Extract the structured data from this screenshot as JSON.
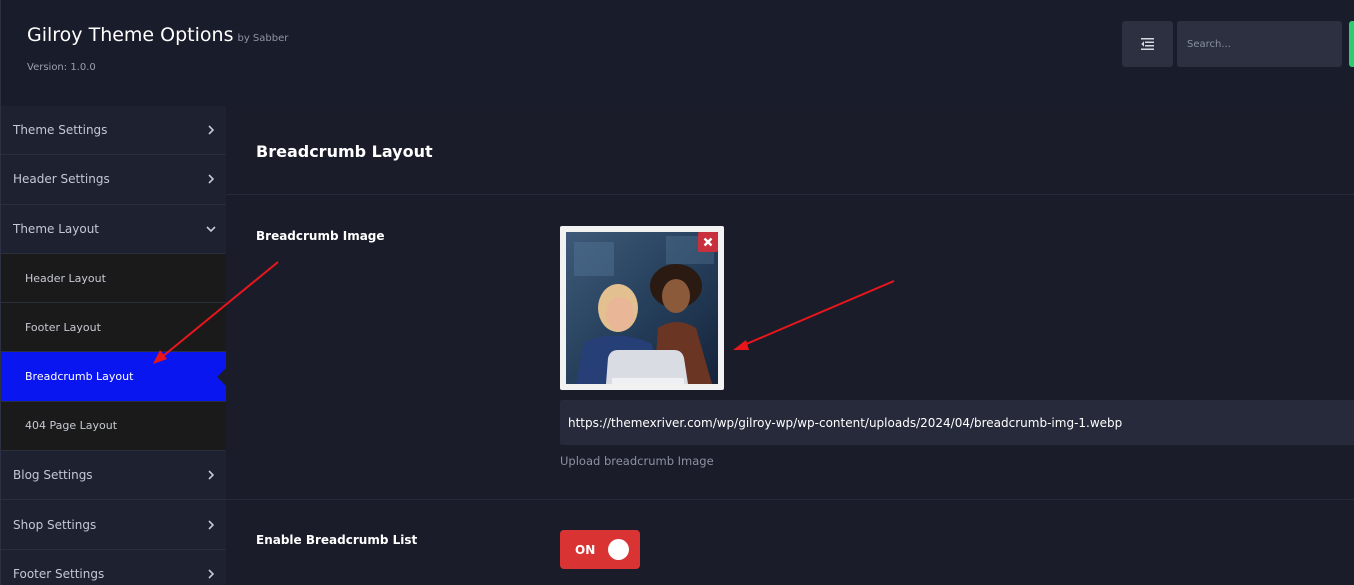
{
  "header": {
    "title": "Gilroy Theme Options",
    "by": "by Sabber",
    "version": "Version: 1.0.0",
    "search_placeholder": "Search..."
  },
  "sidebar": {
    "items": [
      {
        "label": "Theme Settings"
      },
      {
        "label": "Header Settings"
      },
      {
        "label": "Theme Layout"
      },
      {
        "label": "Header Layout"
      },
      {
        "label": "Footer Layout"
      },
      {
        "label": "Breadcrumb Layout"
      },
      {
        "label": "404 Page Layout"
      },
      {
        "label": "Blog Settings"
      },
      {
        "label": "Shop Settings"
      },
      {
        "label": "Footer Settings"
      }
    ]
  },
  "main": {
    "section_title": "Breadcrumb Layout",
    "image_field": {
      "label": "Breadcrumb Image",
      "url": "https://themexriver.com/wp/gilroy-wp/wp-content/uploads/2024/04/breadcrumb-img-1.webp",
      "hint": "Upload breadcrumb Image"
    },
    "list_field": {
      "label": "Enable Breadcrumb List",
      "toggle": "ON"
    }
  },
  "colors": {
    "active_item": "#0a16f0",
    "toggle_on": "#d93333",
    "remove": "#c9303e",
    "annotation_arrow": "#e8161b"
  },
  "icons": {
    "menu_toggle": "collapse-menu-icon",
    "remove": "close-icon",
    "collapsed": "chevron-right-icon",
    "expanded": "chevron-down-icon"
  }
}
